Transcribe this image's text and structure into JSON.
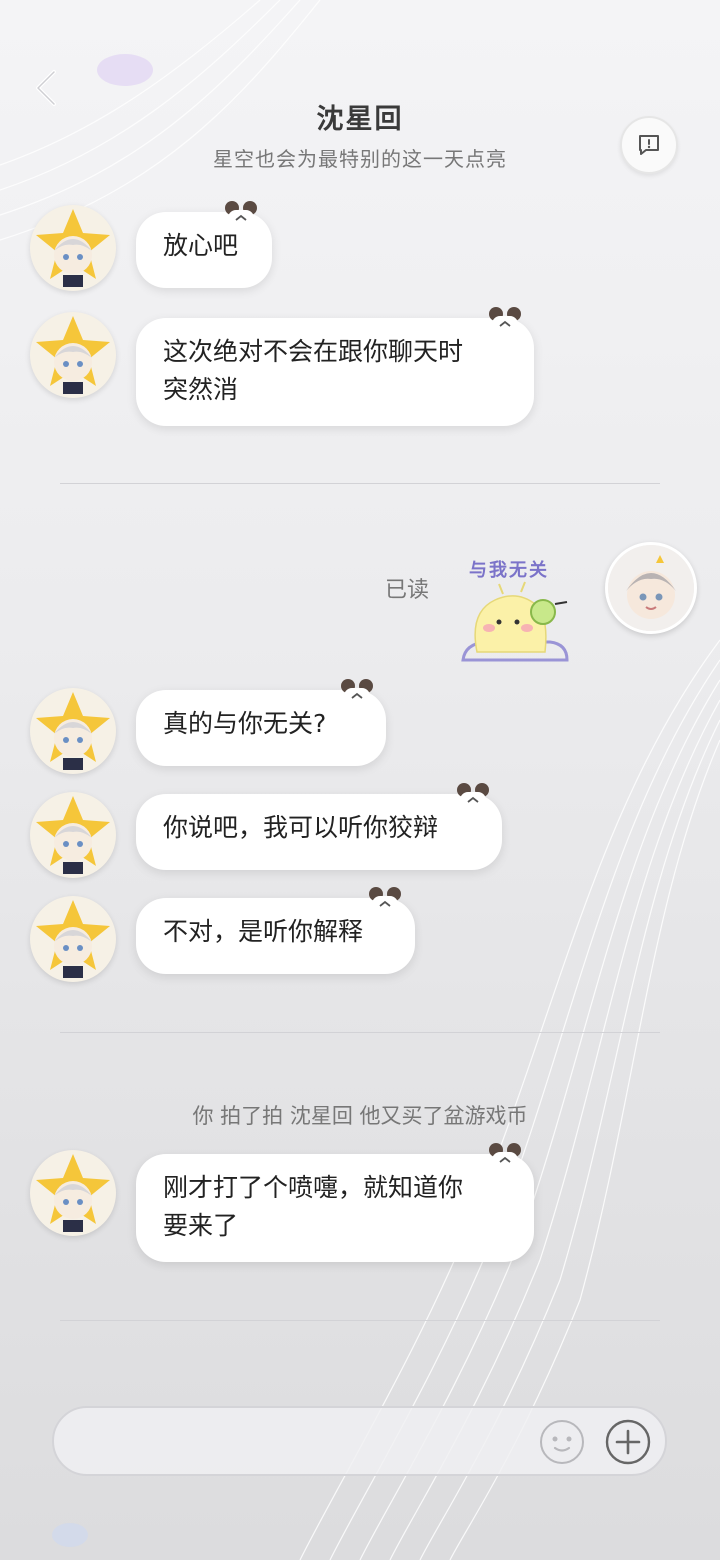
{
  "header": {
    "title": "沈星回",
    "subtitle": "星空也会为最特别的这一天点亮"
  },
  "messages": [
    {
      "text": "放心吧"
    },
    {
      "text": "这次绝对不会在跟你聊天时\n突然消"
    },
    {
      "text": "真的与你无关?"
    },
    {
      "text": "你说吧，我可以听你狡辩"
    },
    {
      "text": "不对，是听你解释"
    },
    {
      "text": "刚才打了个喷嚏，就知道你\n要来了"
    }
  ],
  "read_status": "已读",
  "sticker_text": "与我无关",
  "nudge_text": "你 拍了拍 沈星回 他又买了盆游戏币",
  "input": {
    "placeholder": "",
    "value": ""
  },
  "icons": {
    "back": "chevron-left-icon",
    "report": "chat-report-icon",
    "emoji": "emoji-face-icon",
    "add": "plus-circle-icon"
  },
  "colors": {
    "avatar_star": "#f5c63a",
    "text_gray": "#777777"
  }
}
